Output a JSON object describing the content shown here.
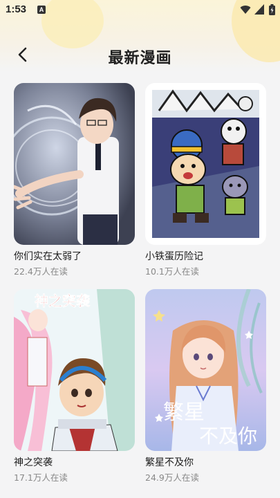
{
  "status_bar": {
    "time": "1:53",
    "notification_badge": "A",
    "icons": [
      "wifi-icon",
      "signal-icon",
      "battery-icon"
    ]
  },
  "header": {
    "back_icon": "chevron-left-icon",
    "title": "最新漫画"
  },
  "comics": [
    {
      "title": "你们实在太弱了",
      "reads": "22.4万人在读"
    },
    {
      "title": "小铁蛋历险记",
      "reads": "10.1万人在读"
    },
    {
      "title": "神之突袭",
      "reads": "17.1万人在读",
      "cover_text": "神之突袭"
    },
    {
      "title": "繁星不及你",
      "reads": "24.9万人在读",
      "cover_text_line1": "繁星",
      "cover_text_line2": "不及你"
    }
  ],
  "colors": {
    "background": "#f4f4f5",
    "header_gradient": "#fbf4d9",
    "secondary_text": "#888888"
  }
}
